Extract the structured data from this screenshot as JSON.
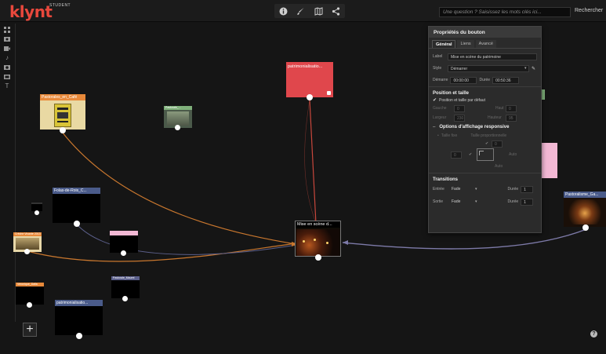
{
  "app": {
    "logo": "klynt",
    "logo_sub": "STUDENT"
  },
  "toolbar": {
    "tools": [
      "info-icon",
      "brush-icon",
      "map-icon",
      "share-icon"
    ]
  },
  "search": {
    "placeholder": "Une question ? Saisissez les mots clés ici...",
    "button": "Rechercher"
  },
  "left_tools": [
    "grid-icon",
    "image-icon",
    "video-icon",
    "music-icon",
    "record-icon",
    "screen-icon",
    "text-icon"
  ],
  "nodes": {
    "patrimonialisation_top": "patrimonialisatio...",
    "pastoralisme_cafe": "Pastorales_en_Café",
    "pastorale_small": "Pastorale_...",
    "foles_de_rois": "Folas-de-Rois_C...",
    "mise_en_scene": "Mise en scène d...",
    "pastoralisme_ga": "Pastoralisme_Ga...",
    "small_left_1": "Crèche Vivante 2013",
    "small_pink": "...",
    "small_orange": "Veronique_Dalla",
    "small_purple": "Pastorale_Maurel",
    "patrimonialisation_bottom": "patrimonialisatio..."
  },
  "panel": {
    "title": "Propriétés du bouton",
    "tabs": [
      "Général",
      "Liens",
      "Avancé"
    ],
    "label_label": "Label",
    "label_value": "Mise en scène du patrimoine",
    "style_label": "Style",
    "style_value": "Démarrer",
    "start_label": "Démarre",
    "start_value": "00:00:00",
    "duration_label": "Durée",
    "duration_value": "00:50:36",
    "position_section": "Position et taille",
    "default_position": "Position et taille par défaut",
    "left_label": "Gauche",
    "left_value": "0",
    "top_label": "Haut",
    "top_value": "0",
    "width_label": "Largeur",
    "width_value": "230",
    "height_label": "Hauteur",
    "height_value": "95",
    "responsive_section": "Options d'affichage responsive",
    "fixed_size": "Taille fixe",
    "proportional_size": "Taille proportionnelle",
    "grid_value_top": "0",
    "grid_value_left": "0",
    "grid_right": "Auto",
    "grid_bottom": "Auto",
    "transitions_section": "Transitions",
    "entry_label": "Entrée",
    "entry_value": "Fade",
    "entry_duration_label": "Durée",
    "entry_duration_value": "1",
    "exit_label": "Sortie",
    "exit_value": "Fade",
    "exit_duration_label": "Durée",
    "exit_duration_value": "1"
  },
  "colors": {
    "accent": "#e8483c",
    "node_red": "#e0474c",
    "node_blue": "#4a5b8a",
    "node_pink": "#f2b8d4",
    "edge_orange": "#c9772e",
    "edge_red": "#c9473c",
    "edge_purple": "#7d7aa8"
  }
}
